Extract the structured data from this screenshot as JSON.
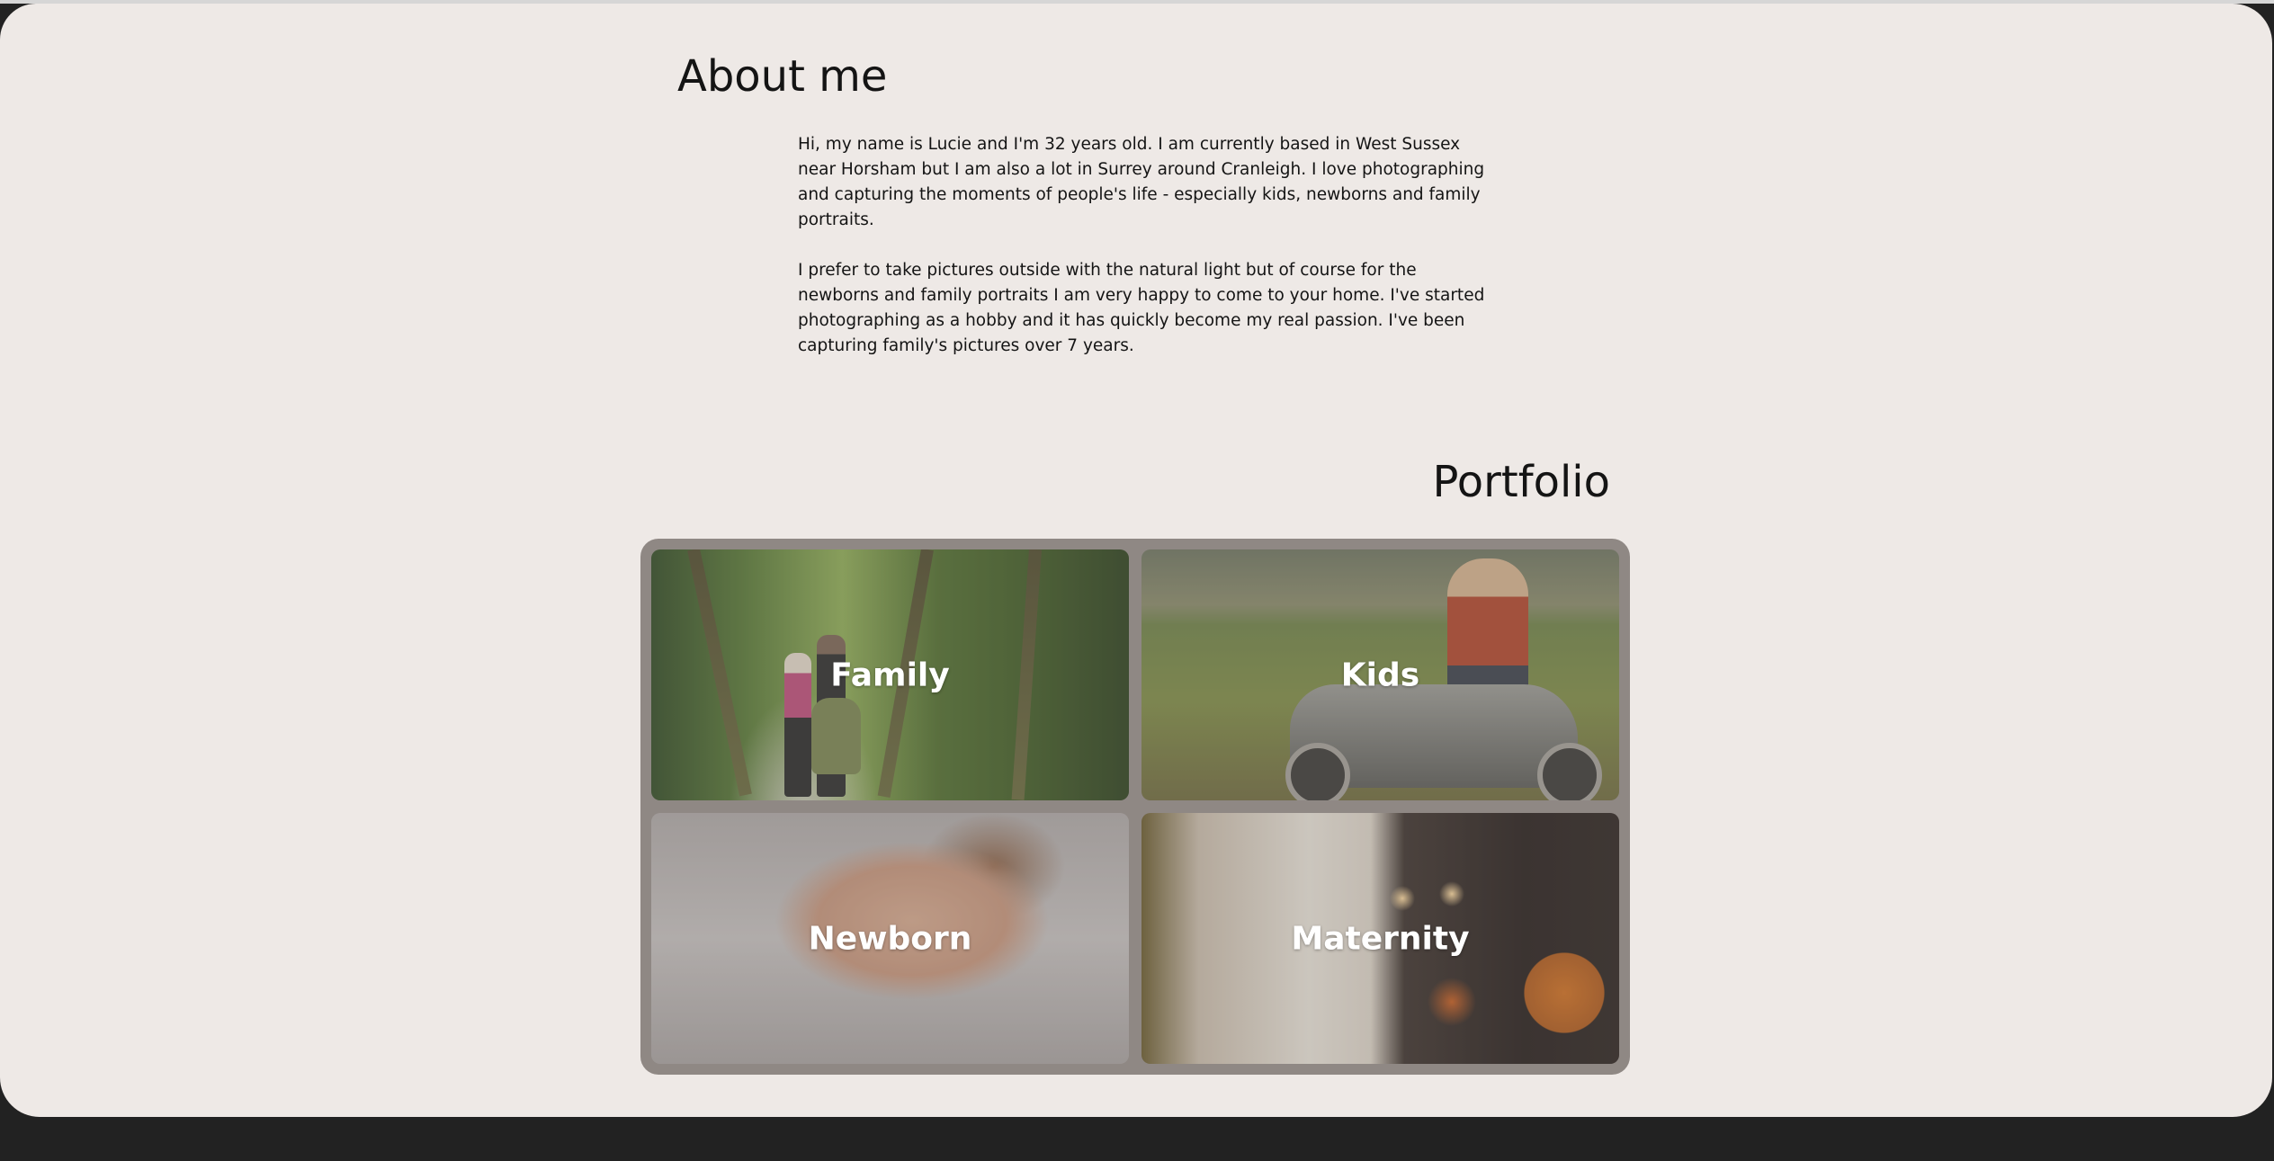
{
  "about": {
    "heading": "About me",
    "paragraphs": [
      "Hi, my name is Lucie and I'm 32 years old. I am currently based in West Sussex near Horsham but I am also a lot in Surrey around Cranleigh. I love photographing and capturing the moments of people's life - especially kids, newborns and family portraits.",
      "I prefer to take pictures outside with the natural light but of course for the newborns and family portraits I am very happy to come to your home. I've started photographing as a hobby and it has quickly become my real passion. I've been capturing family's pictures over 7 years."
    ]
  },
  "portfolio": {
    "heading": "Portfolio",
    "items": [
      {
        "label": "Family"
      },
      {
        "label": "Kids"
      },
      {
        "label": "Newborn"
      },
      {
        "label": "Maternity"
      }
    ]
  }
}
